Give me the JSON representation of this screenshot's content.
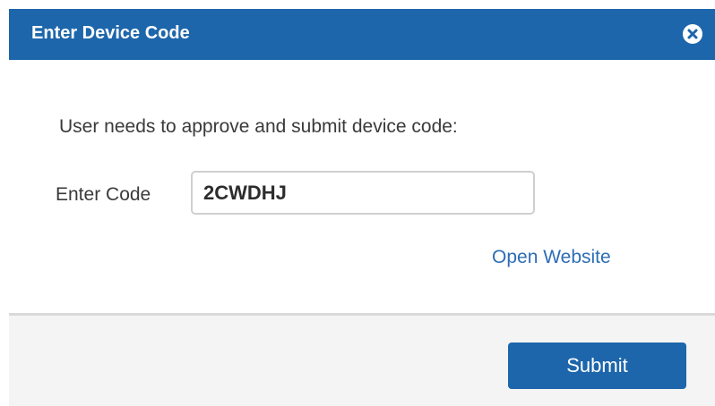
{
  "dialog": {
    "title": "Enter Device Code",
    "close_icon": "close-circle-icon",
    "instruction": "User needs to approve and submit device code:",
    "code_label": "Enter Code",
    "code_value": "2CWDHJ",
    "open_website_label": "Open Website",
    "submit_label": "Submit"
  },
  "colors": {
    "titlebar": "#1d66ab",
    "link": "#2d6db5",
    "footer": "#f4f4f4"
  }
}
